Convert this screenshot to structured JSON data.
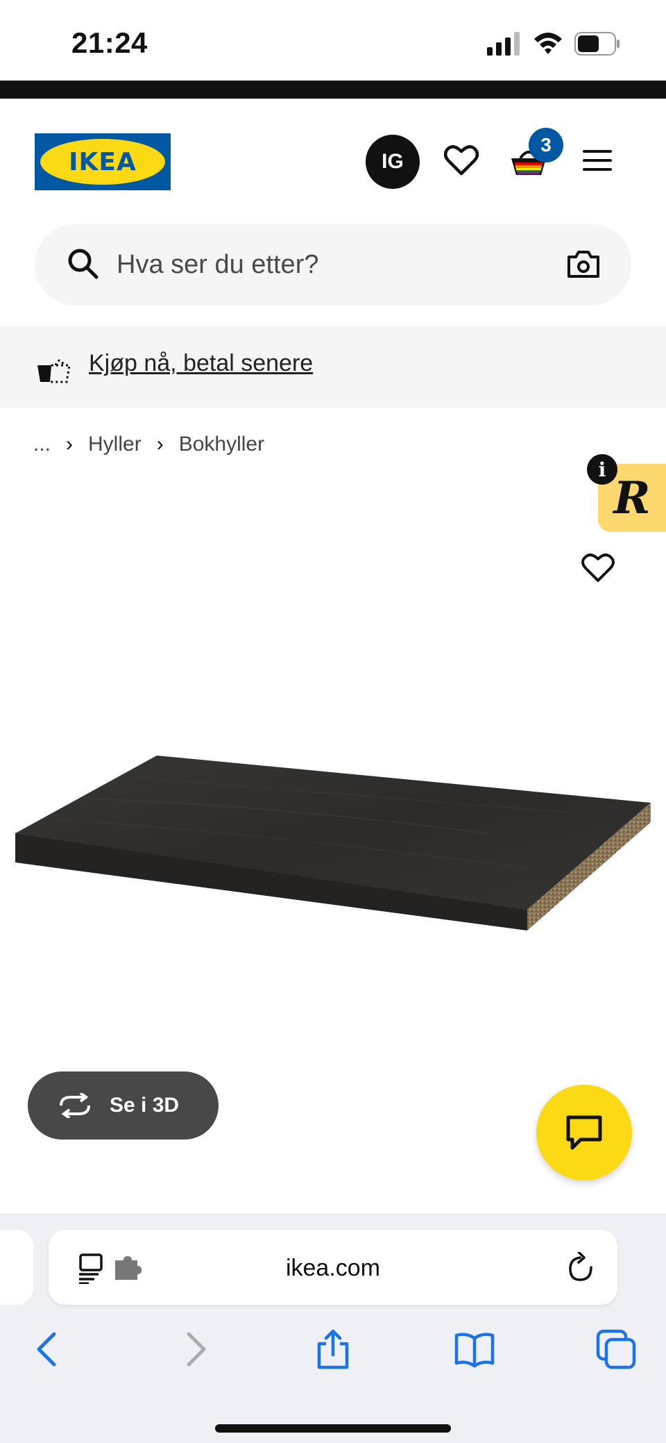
{
  "status_bar": {
    "time": "21:24"
  },
  "header": {
    "logo_text": "IKEA",
    "avatar_initials": "IG",
    "cart_count": "3",
    "colors": {
      "brand_blue": "#0058a3",
      "brand_yellow": "#fbd914"
    }
  },
  "search": {
    "placeholder": "Hva ser du etter?"
  },
  "promo": {
    "link_text": "Kjøp nå, betal senere"
  },
  "breadcrumb": {
    "ellipsis": "...",
    "items": [
      "Hyller",
      "Bokhyller"
    ]
  },
  "side_widget": {
    "letter": "R",
    "info": "i"
  },
  "product": {
    "view_3d_label": "Se i 3D"
  },
  "browser": {
    "url": "ikea.com"
  },
  "icons": {
    "signal": "cellular-signal-icon",
    "wifi": "wifi-icon",
    "battery": "battery-icon",
    "favorites": "heart-icon",
    "cart": "shopping-bag-icon",
    "menu": "hamburger-menu-icon",
    "search": "search-icon",
    "camera": "camera-icon",
    "chat": "chat-icon",
    "back": "back-chevron-icon",
    "forward": "forward-chevron-icon",
    "share": "share-icon",
    "bookmarks": "book-icon",
    "tabs": "tabs-icon",
    "reload": "reload-icon"
  }
}
